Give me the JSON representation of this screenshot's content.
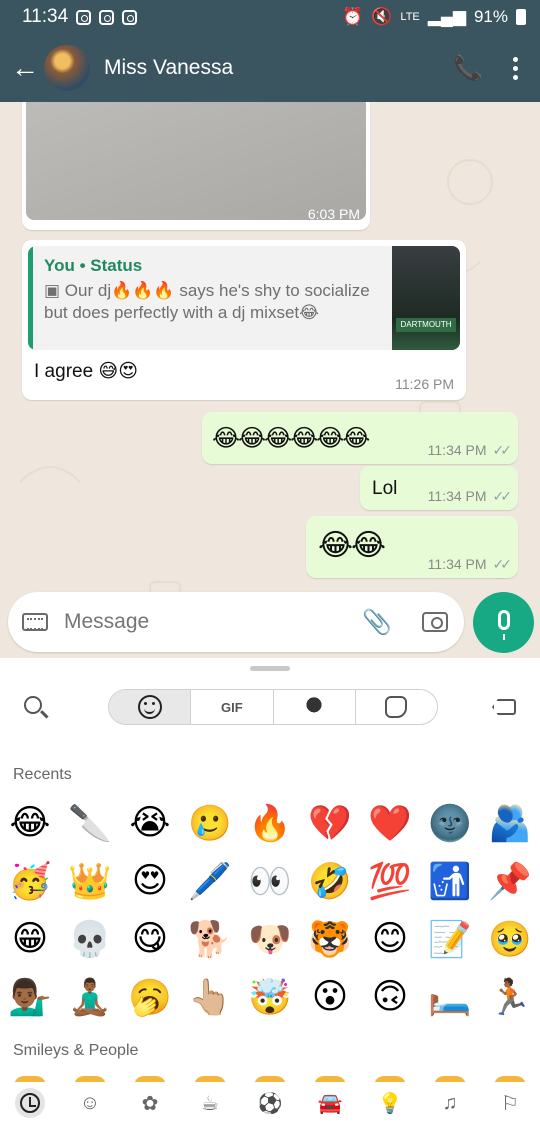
{
  "status_bar": {
    "time": "11:34",
    "network": "LTE",
    "battery": "91%"
  },
  "header": {
    "contact_name": "Miss Vanessa",
    "back_icon": "arrow-left-icon",
    "call_icon": "add-call-icon",
    "menu_icon": "more-vertical-icon"
  },
  "messages": [
    {
      "type": "image",
      "direction": "in",
      "time": "6:03 PM"
    },
    {
      "type": "reply",
      "direction": "in",
      "quote_author": "You • Status",
      "quote_text": "Our dj🔥🔥🔥 says he's shy to socialize but does perfectly with a dj mixset😂",
      "thumb_label": "DARTMOUTH",
      "text": "I agree 😅😍",
      "time": "11:26 PM"
    },
    {
      "type": "text",
      "direction": "out",
      "text": "😂😂😂😂😂😂",
      "time": "11:34 PM"
    },
    {
      "type": "text",
      "direction": "out",
      "text": "Lol",
      "time": "11:34 PM"
    },
    {
      "type": "text",
      "direction": "out",
      "text": "😂😂",
      "time": "11:34 PM"
    }
  ],
  "composer": {
    "placeholder": "Message"
  },
  "emoji_panel": {
    "tabs": [
      "emoji",
      "GIF",
      "avatar",
      "sticker"
    ],
    "gif_label": "GIF",
    "recents_label": "Recents",
    "smileys_label": "Smileys & People",
    "recents": [
      "😂",
      "🔪",
      "😭",
      "🥲",
      "🔥",
      "💔",
      "❤️",
      "🌚",
      "🫂",
      "🥳",
      "👑",
      "😍",
      "🖊️",
      "👀",
      "🤣",
      "💯",
      "🚮",
      "📌",
      "😁",
      "💀",
      "😋",
      "🐕",
      "🐶",
      "🐯",
      "😊",
      "📝",
      "🥹",
      "💁🏾‍♂️",
      "🧘🏾‍♂️",
      "🥱",
      "👆🏼",
      "🤯",
      "😮",
      "🙃",
      "🛏️",
      "🏃🏾"
    ],
    "categories": [
      "recent-icon",
      "smileys-icon",
      "animals-icon",
      "food-icon",
      "activity-icon",
      "travel-icon",
      "objects-icon",
      "symbols-icon",
      "flags-icon"
    ]
  },
  "colors": {
    "header": "#3b5560",
    "chat_bg": "#efe7dd",
    "outgoing": "#e7fcd6",
    "accent": "#17a884",
    "quote_bar": "#1f9d6f"
  }
}
